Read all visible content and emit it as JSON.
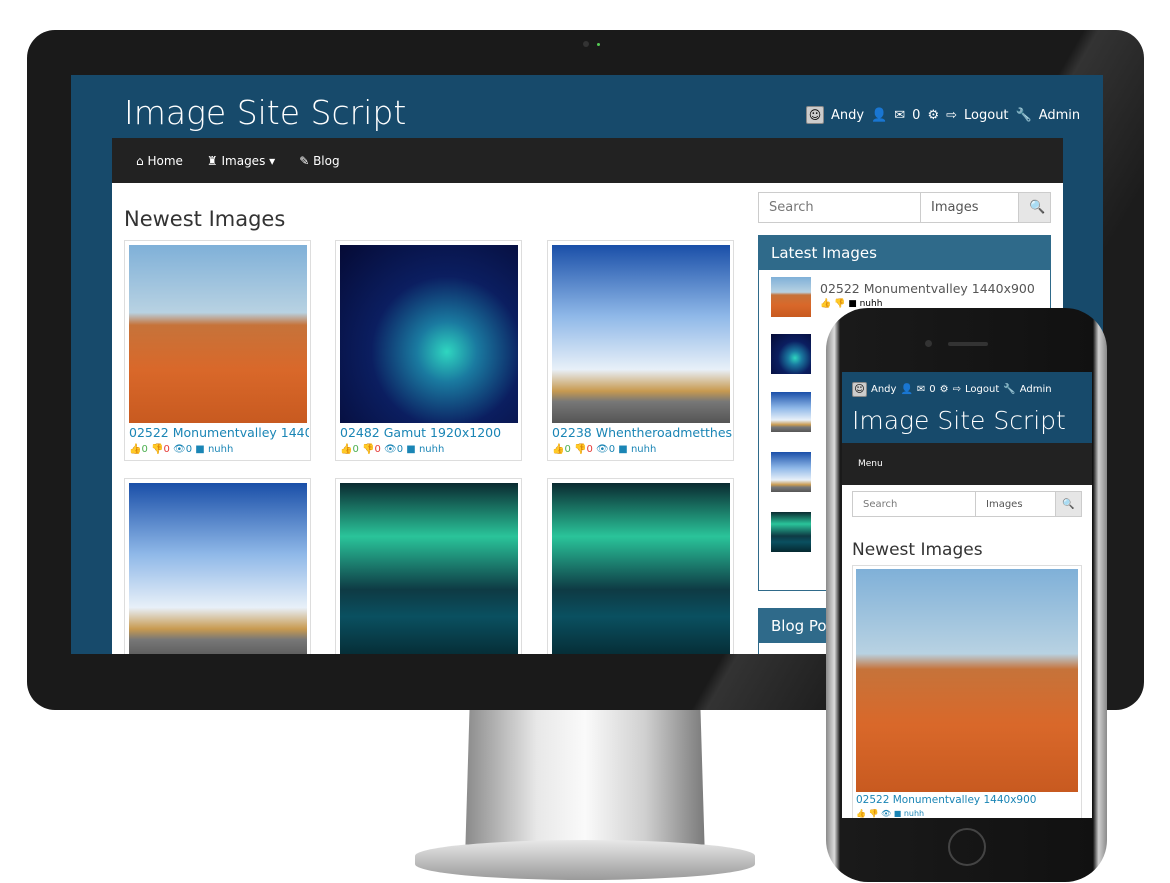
{
  "site": {
    "title": "Image Site Script"
  },
  "user": {
    "name": "Andy",
    "messages": "0",
    "logout": "Logout",
    "admin": "Admin"
  },
  "nav": {
    "home": "Home",
    "images": "Images",
    "blog": "Blog",
    "menu": "Menu"
  },
  "search": {
    "placeholder": "Search",
    "scope": "Images"
  },
  "main": {
    "heading": "Newest Images",
    "cards": [
      {
        "title": "02522 Monumentvalley 1440...",
        "likes": "0",
        "dislikes": "0",
        "views": "0",
        "category": "nuhh"
      },
      {
        "title": "02482 Gamut 1920x1200",
        "likes": "0",
        "dislikes": "0",
        "views": "0",
        "category": "nuhh"
      },
      {
        "title": "02238 Whentheroadmetthes...",
        "likes": "0",
        "dislikes": "0",
        "views": "0",
        "category": "nuhh"
      }
    ]
  },
  "sidebar": {
    "latest_title": "Latest Images",
    "latest_first": "02522 Monumentvalley 1440x900",
    "latest_first_category": "nuhh",
    "blog_title": "Blog Posts"
  },
  "phone": {
    "card_title": "02522 Monumentvalley 1440x900",
    "card_category": "nuhh"
  }
}
